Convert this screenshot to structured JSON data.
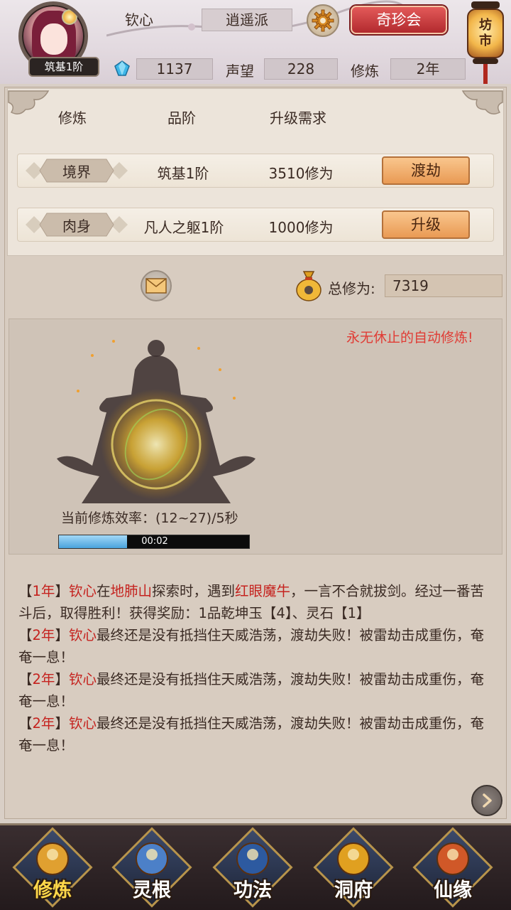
{
  "player": {
    "name": "钦心",
    "realm_badge": "筑基1阶",
    "sect": "逍遥派",
    "gems": "1137",
    "prestige_label": "声望",
    "prestige": "228",
    "cultivation_label": "修炼",
    "cultivation_years": "2年"
  },
  "header": {
    "treasure_button": "奇珍会",
    "market_line1": "坊",
    "market_line2": "市"
  },
  "table": {
    "headers": [
      "修炼",
      "品阶",
      "升级需求"
    ],
    "rows": [
      {
        "tag": "境界",
        "grade": "筑基1阶",
        "requirement": "3510修为",
        "action": "渡劫"
      },
      {
        "tag": "肉身",
        "grade": "凡人之躯1阶",
        "requirement": "1000修为",
        "action": "升级"
      }
    ]
  },
  "total": {
    "label": "总修为:",
    "value": "7319"
  },
  "scene": {
    "auto_note": "永无休止的自动修炼!",
    "rate_text": "当前修炼效率：(12~27)/5秒",
    "progress_time": "00:02",
    "progress_fraction": 0.36
  },
  "log": [
    {
      "parts": [
        {
          "t": "【",
          "hl": false
        },
        {
          "t": "1年",
          "hl": true
        },
        {
          "t": "】",
          "hl": false
        },
        {
          "t": "钦心",
          "hl": true
        },
        {
          "t": "在",
          "hl": false
        },
        {
          "t": "地肺山",
          "hl": true
        },
        {
          "t": "探索时，遇到",
          "hl": false
        },
        {
          "t": "红眼魔牛",
          "hl": true
        },
        {
          "t": "，一言不合就拔剑。经过一番苦斗后，取得胜利！获得奖励：1品乾坤玉【4】、灵石【1】",
          "hl": false
        }
      ]
    },
    {
      "parts": [
        {
          "t": "【",
          "hl": false
        },
        {
          "t": "2年",
          "hl": true
        },
        {
          "t": "】",
          "hl": false
        },
        {
          "t": "钦心",
          "hl": true
        },
        {
          "t": "最终还是没有抵挡住天威浩荡，渡劫失败！被雷劫击成重伤，奄奄一息！",
          "hl": false
        }
      ]
    },
    {
      "parts": [
        {
          "t": "【",
          "hl": false
        },
        {
          "t": "2年",
          "hl": true
        },
        {
          "t": "】",
          "hl": false
        },
        {
          "t": "钦心",
          "hl": true
        },
        {
          "t": "最终还是没有抵挡住天威浩荡，渡劫失败！被雷劫击成重伤，奄奄一息！",
          "hl": false
        }
      ]
    },
    {
      "parts": [
        {
          "t": "【",
          "hl": false
        },
        {
          "t": "2年",
          "hl": true
        },
        {
          "t": "】",
          "hl": false
        },
        {
          "t": "钦心",
          "hl": true
        },
        {
          "t": "最终还是没有抵挡住天威浩荡，渡劫失败！被雷劫击成重伤，奄奄一息！",
          "hl": false
        }
      ]
    }
  ],
  "nav": [
    {
      "label": "修炼",
      "icon": "meditating-monk-icon",
      "active": true
    },
    {
      "label": "灵根",
      "icon": "sword-root-icon",
      "active": false
    },
    {
      "label": "功法",
      "icon": "scroll-book-icon",
      "active": false
    },
    {
      "label": "洞府",
      "icon": "pavilion-icon",
      "active": false
    },
    {
      "label": "仙缘",
      "icon": "gourd-icon",
      "active": false
    }
  ],
  "colors": {
    "highlight": "#c5221e",
    "auto_note": "#e03b34",
    "nav_active": "#ffd84a",
    "action_button": "#f2ad6b"
  }
}
